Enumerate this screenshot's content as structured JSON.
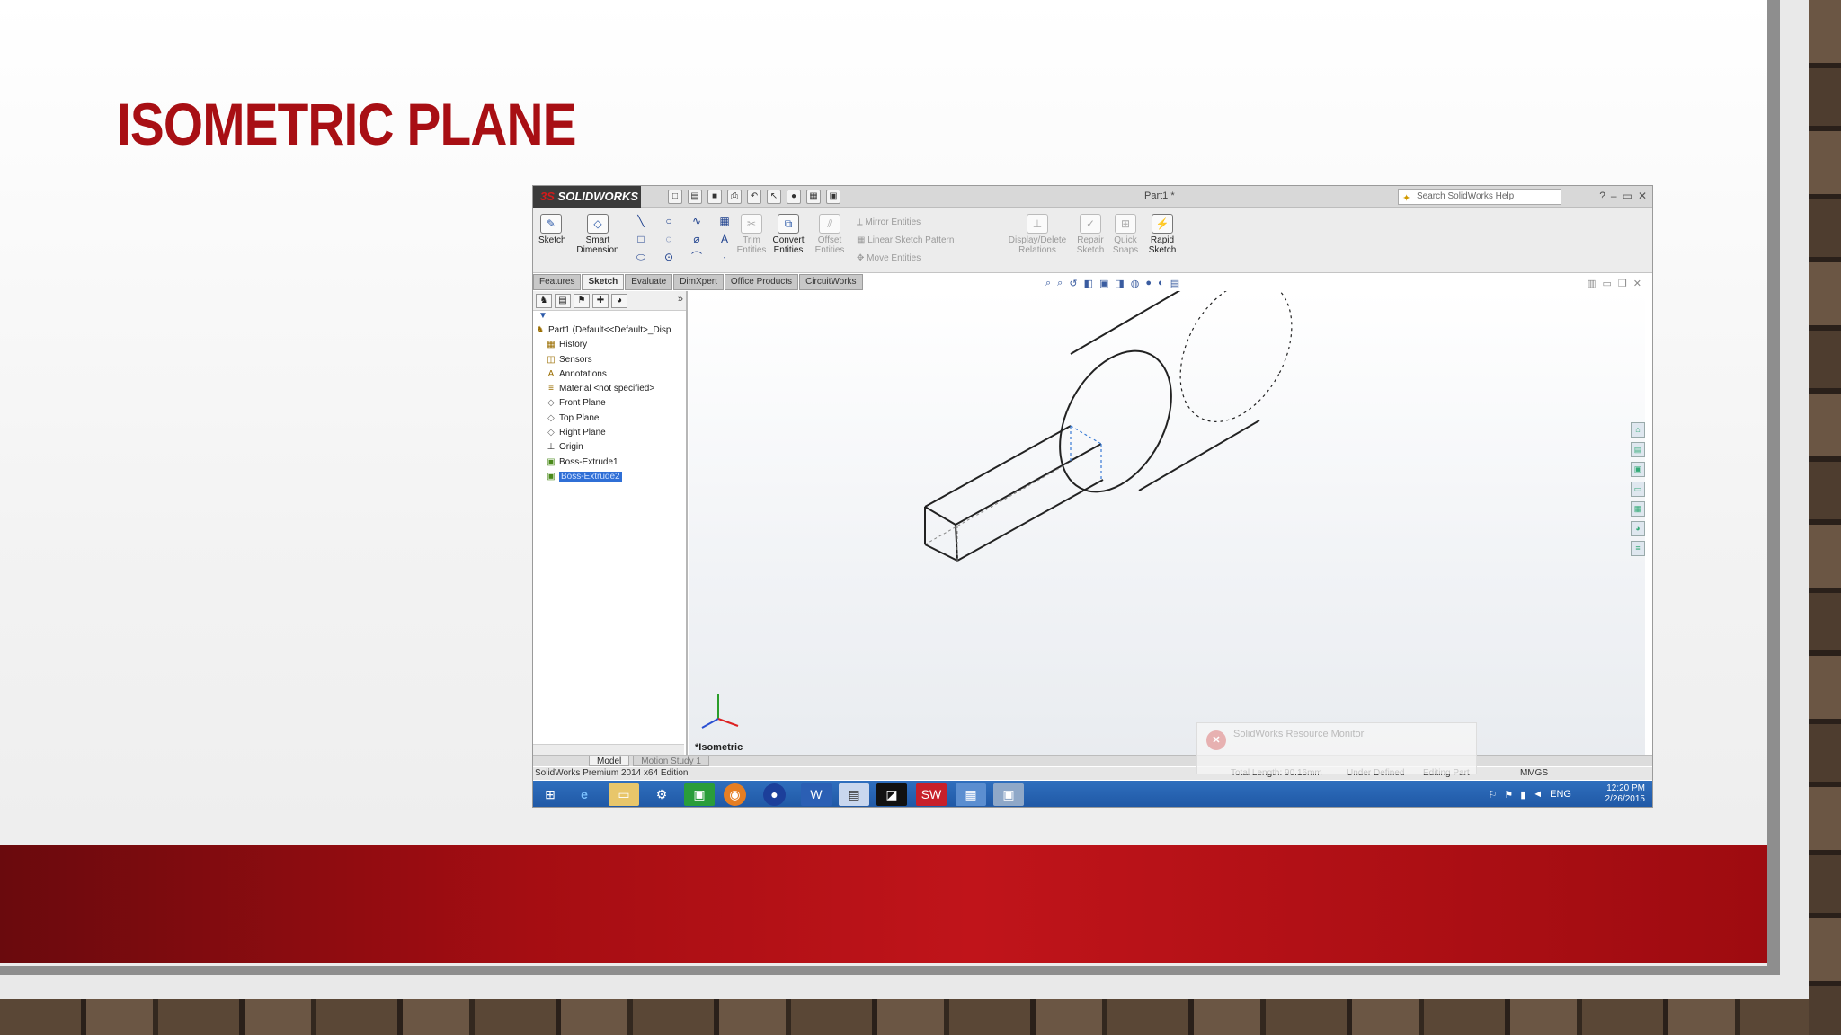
{
  "slide": {
    "title": "ISOMETRIC PLANE"
  },
  "app": {
    "brand": "SOLIDWORKS",
    "document_title": "Part1 *",
    "search_placeholder": "Search SolidWorks Help"
  },
  "ribbon": {
    "sketch": "Sketch",
    "smart_dimension": [
      "Smart",
      "Dimension"
    ],
    "trim_entities": [
      "Trim",
      "Entities"
    ],
    "convert_entities": [
      "Convert",
      "Entities"
    ],
    "offset_entities": [
      "Offset",
      "Entities"
    ],
    "mirror_entities": "Mirror Entities",
    "linear_sketch_pattern": "Linear Sketch Pattern",
    "move_entities": "Move Entities",
    "display_delete_relations": [
      "Display/Delete",
      "Relations"
    ],
    "repair_sketch": [
      "Repair",
      "Sketch"
    ],
    "quick_snaps": [
      "Quick",
      "Snaps"
    ],
    "rapid_sketch": [
      "Rapid",
      "Sketch"
    ]
  },
  "command_tabs": [
    "Features",
    "Sketch",
    "Evaluate",
    "DimXpert",
    "Office Products",
    "CircuitWorks"
  ],
  "active_command_tab": "Sketch",
  "feature_tree": {
    "root": "Part1  (Default<<Default>_Disp",
    "items": [
      "History",
      "Sensors",
      "Annotations",
      "Material <not specified>",
      "Front Plane",
      "Top Plane",
      "Right Plane",
      "Origin",
      "Boss-Extrude1",
      "Boss-Extrude2"
    ],
    "selected": "Boss-Extrude2"
  },
  "viewport": {
    "view_label": "*Isometric"
  },
  "model_tabs": [
    "Model",
    "Motion Study 1"
  ],
  "status": {
    "edition": "SolidWorks Premium 2014 x64 Edition",
    "total_length": "Total Length: 90.16mm",
    "definition": "Under Defined",
    "mode": "Editing Part",
    "units": "MMGS"
  },
  "notification": {
    "title": "SolidWorks Resource Monitor"
  },
  "taskbar": {
    "language": "ENG",
    "time": "12:20 PM",
    "date": "2/26/2015"
  }
}
